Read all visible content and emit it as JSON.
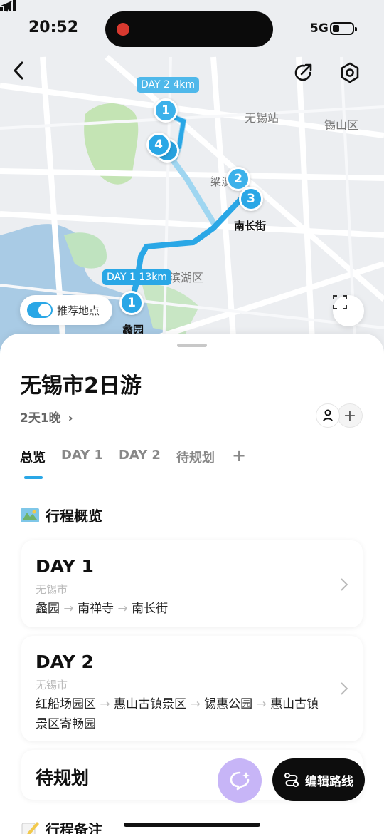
{
  "status_bar": {
    "time": "20:52",
    "network": "5G"
  },
  "map": {
    "labels": {
      "wuxi_station": "无锡站",
      "xishan": "锡山区",
      "liangxi": "梁溪",
      "nanchang": "南长街",
      "binhu": "滨湖区",
      "liyuan": "蠡园"
    },
    "day_tags": {
      "day1": "DAY 1 13km",
      "day2": "DAY 2 4km"
    },
    "pins": [
      "1",
      "4",
      "2",
      "3",
      "1"
    ],
    "toggle_label": "推荐地点",
    "accent_color": "#2aa7e6"
  },
  "trip": {
    "title": "无锡市2日游",
    "duration": "2天1晚",
    "tabs": [
      "总览",
      "DAY 1",
      "DAY 2",
      "待规划"
    ],
    "tab_add": "+",
    "member_add": "+"
  },
  "overview": {
    "heading": "行程概览",
    "days": [
      {
        "day": "DAY 1",
        "city": "无锡市",
        "stops": [
          "蠡园",
          "南禅寺",
          "南长街"
        ]
      },
      {
        "day": "DAY 2",
        "city": "无锡市",
        "stops": [
          "红船场园区",
          "惠山古镇景区",
          "锡惠公园",
          "惠山古镇景区寄畅园"
        ]
      }
    ],
    "plan_title": "待规划",
    "notes_heading": "行程备注",
    "edit_route": "编辑路线"
  }
}
